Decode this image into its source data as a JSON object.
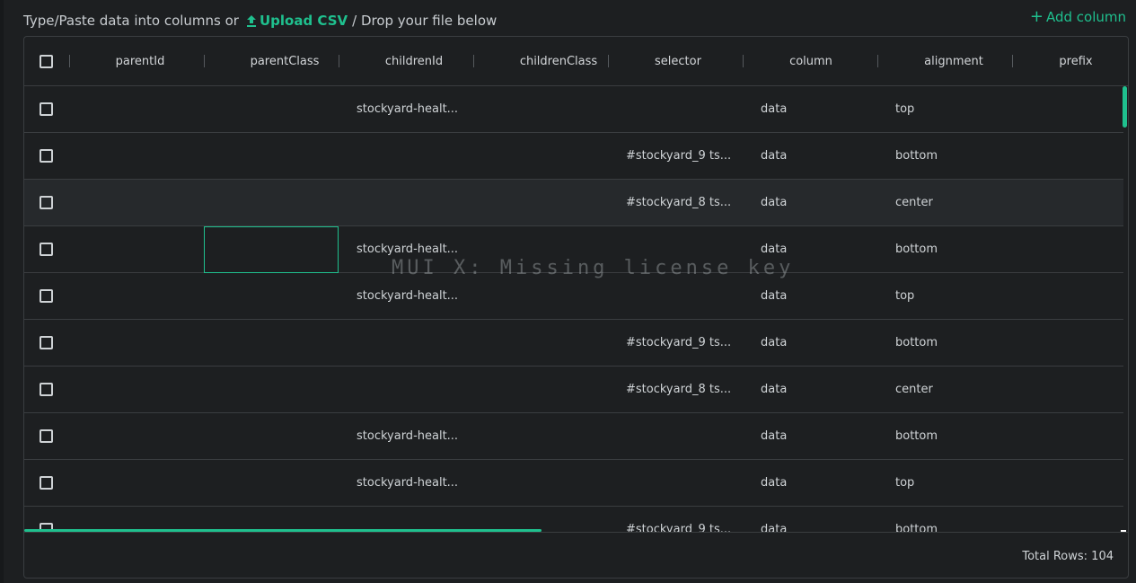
{
  "toolbar": {
    "prefix_text": "Type/Paste data into columns or",
    "upload_label": "Upload CSV",
    "suffix_text": "/ Drop your file below",
    "add_column_label": "Add column",
    "upload_icon": "upload-arrow-icon",
    "add_icon": "plus-icon"
  },
  "columns": [
    "parentId",
    "parentClass",
    "childrenId",
    "childrenClass",
    "selector",
    "column",
    "alignment",
    "prefix"
  ],
  "rows": [
    {
      "childrenId": "stockyard-healt...",
      "selector": "",
      "column": "data",
      "alignment": "top"
    },
    {
      "childrenId": "",
      "selector": "#stockyard_9 ts...",
      "column": "data",
      "alignment": "bottom"
    },
    {
      "childrenId": "",
      "selector": "#stockyard_8 ts...",
      "column": "data",
      "alignment": "center"
    },
    {
      "childrenId": "stockyard-healt...",
      "selector": "",
      "column": "data",
      "alignment": "bottom"
    },
    {
      "childrenId": "stockyard-healt...",
      "selector": "",
      "column": "data",
      "alignment": "top"
    },
    {
      "childrenId": "",
      "selector": "#stockyard_9 ts...",
      "column": "data",
      "alignment": "bottom"
    },
    {
      "childrenId": "",
      "selector": "#stockyard_8 ts...",
      "column": "data",
      "alignment": "center"
    },
    {
      "childrenId": "stockyard-healt...",
      "selector": "",
      "column": "data",
      "alignment": "bottom"
    },
    {
      "childrenId": "stockyard-healt...",
      "selector": "",
      "column": "data",
      "alignment": "top"
    },
    {
      "childrenId": "",
      "selector": "#stockyard_9 ts...",
      "column": "data",
      "alignment": "bottom"
    }
  ],
  "footer": {
    "total_rows_label": "Total Rows: 104"
  },
  "watermark": "MUI X: Missing license key",
  "colors": {
    "accent": "#1fc08e",
    "background": "#1d1f21",
    "border": "#3a3d40"
  }
}
